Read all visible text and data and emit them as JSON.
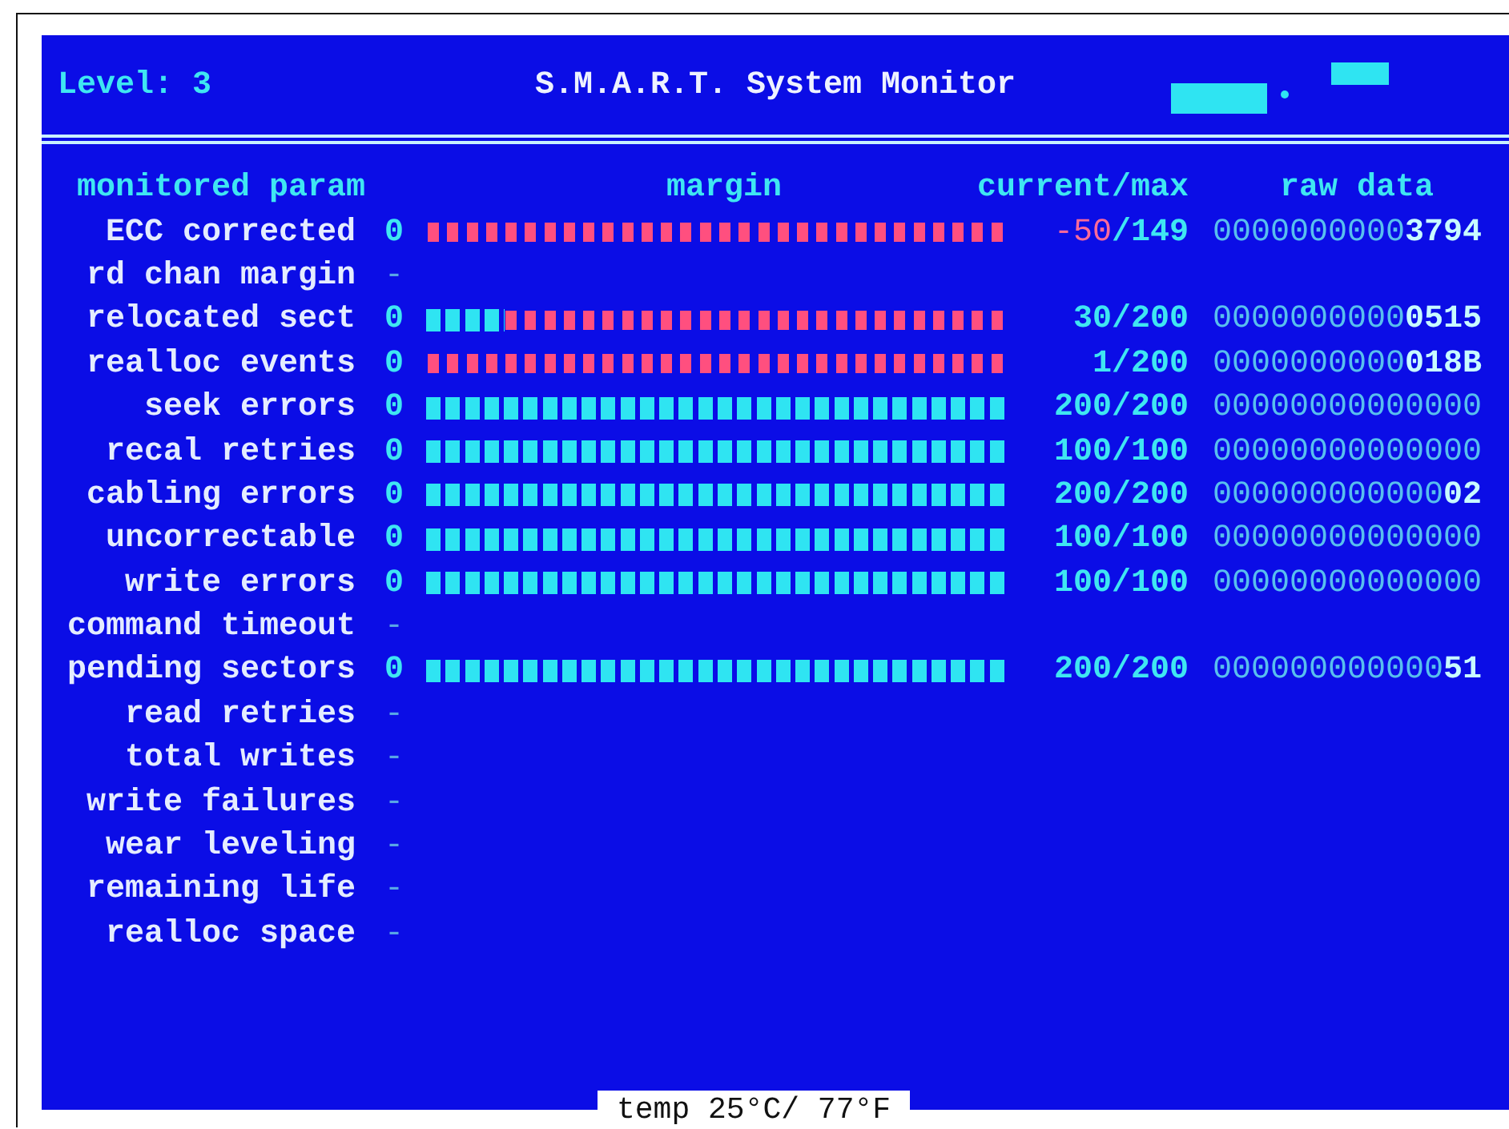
{
  "header": {
    "level_label": "Level: 3",
    "title": "S.M.A.R.T. System Monitor"
  },
  "columns": {
    "param": "monitored param",
    "margin": "margin",
    "current_max": "current/max",
    "raw": "raw data"
  },
  "rows": [
    {
      "name": "ECC corrected",
      "kind": "bar",
      "threshold": "0",
      "level": 0,
      "value": "-50/149",
      "alert": true,
      "raw": "0000000000**3794**"
    },
    {
      "name": "rd chan margin",
      "kind": "na",
      "threshold": "-"
    },
    {
      "name": "relocated sect",
      "kind": "bar",
      "threshold": "0",
      "level": 0.1333,
      "value": "30/200",
      "alert": false,
      "raw": "0000000000**0515**"
    },
    {
      "name": "realloc events",
      "kind": "bar",
      "threshold": "0",
      "level": 0,
      "value": "1/200",
      "alert": false,
      "raw": "0000000000**018B**"
    },
    {
      "name": "seek errors",
      "kind": "bar",
      "threshold": "0",
      "level": 1,
      "value": "200/200",
      "alert": false,
      "raw": "00000000000000"
    },
    {
      "name": "recal retries",
      "kind": "bar",
      "threshold": "0",
      "level": 1,
      "value": "100/100",
      "alert": false,
      "raw": "00000000000000"
    },
    {
      "name": "cabling errors",
      "kind": "bar",
      "threshold": "0",
      "level": 1,
      "value": "200/200",
      "alert": false,
      "raw": "000000000000**02**"
    },
    {
      "name": "uncorrectable",
      "kind": "bar",
      "threshold": "0",
      "level": 1,
      "value": "100/100",
      "alert": false,
      "raw": "00000000000000"
    },
    {
      "name": "write errors",
      "kind": "bar",
      "threshold": "0",
      "level": 1,
      "value": "100/100",
      "alert": false,
      "raw": "00000000000000"
    },
    {
      "name": "command timeout",
      "kind": "na",
      "threshold": "-"
    },
    {
      "name": "pending sectors",
      "kind": "bar",
      "threshold": "0",
      "level": 1,
      "value": "200/200",
      "alert": false,
      "raw": "000000000000**51**"
    },
    {
      "name": "read retries",
      "kind": "na",
      "threshold": "-"
    },
    {
      "name": "total writes",
      "kind": "na",
      "threshold": "-"
    },
    {
      "name": "write failures",
      "kind": "na",
      "threshold": "-"
    },
    {
      "name": "wear leveling",
      "kind": "na",
      "threshold": "-"
    },
    {
      "name": "remaining life",
      "kind": "na",
      "threshold": "-"
    },
    {
      "name": "realloc space",
      "kind": "na",
      "threshold": "-"
    }
  ],
  "status_bar": {
    "temperature": "temp 25°C/ 77°F"
  }
}
